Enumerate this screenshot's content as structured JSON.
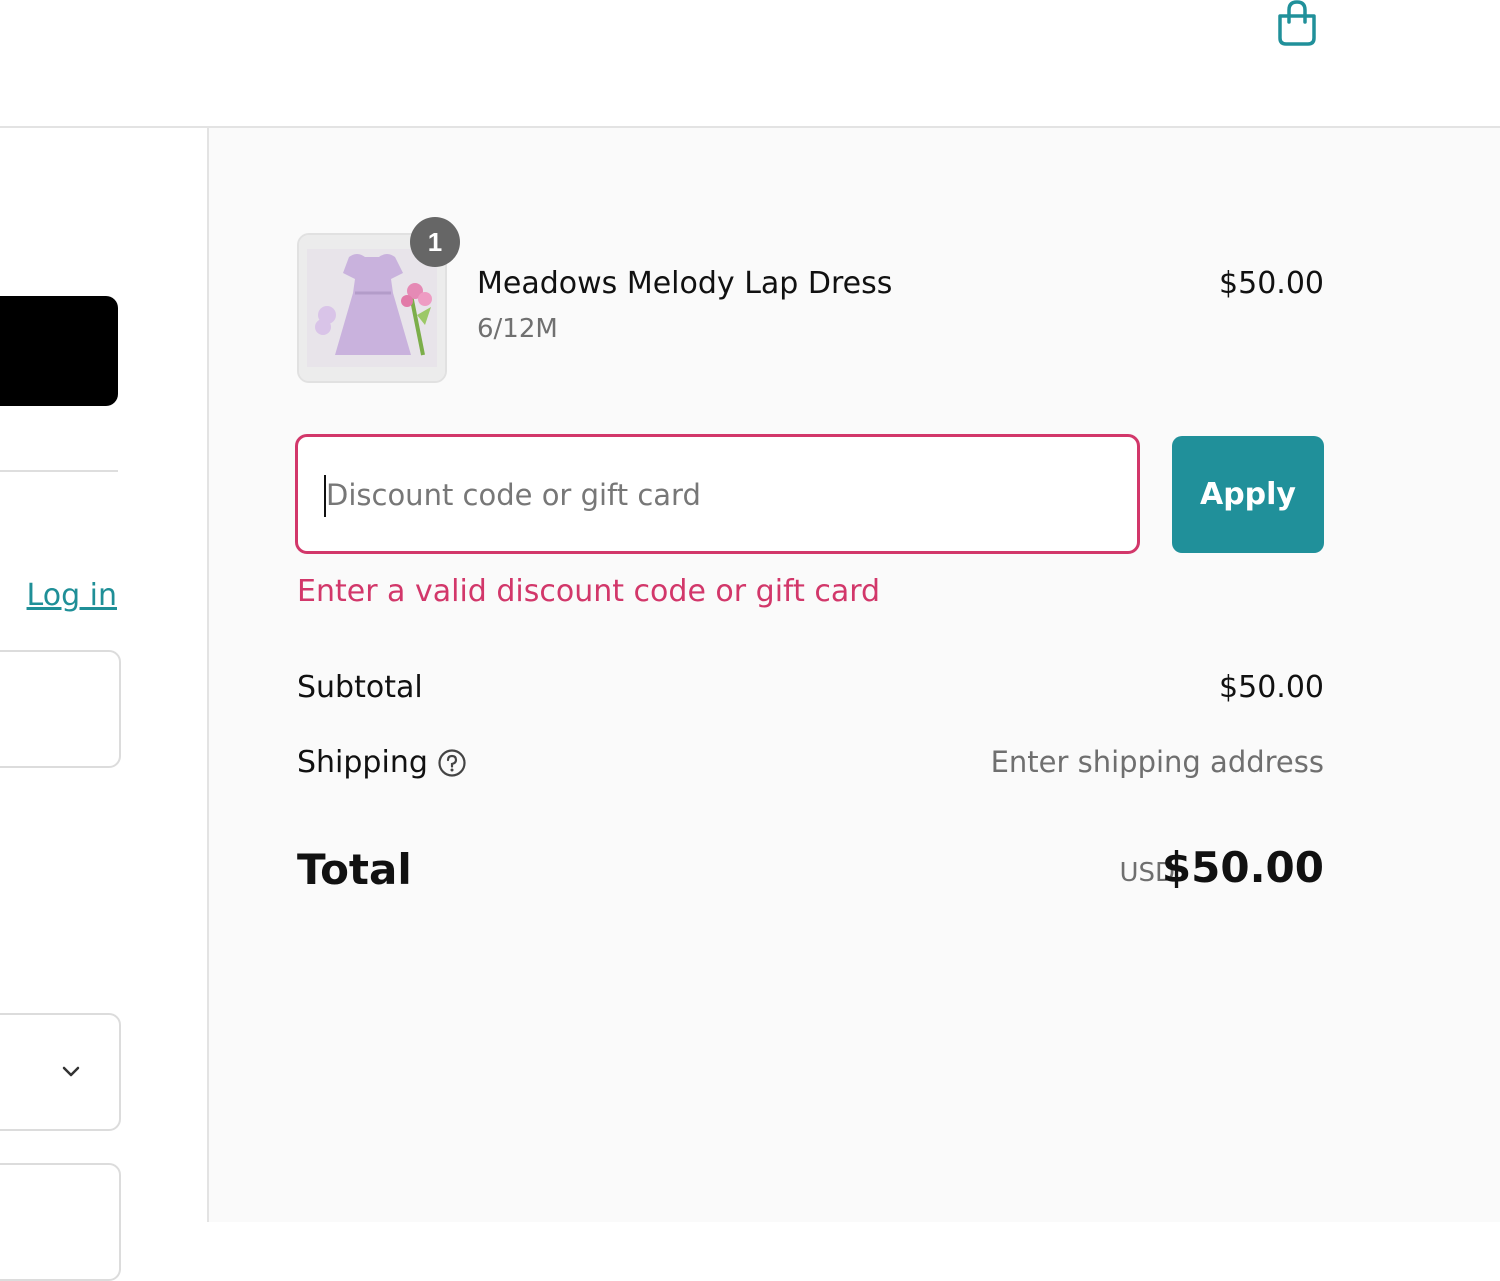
{
  "header": {
    "cart_icon": "shopping-bag-icon"
  },
  "left": {
    "login_label": "Log in",
    "chevron_icon": "chevron-down-icon"
  },
  "order": {
    "item": {
      "quantity": "1",
      "name": "Meadows Melody Lap Dress",
      "variant": "6/12M",
      "price": "$50.00"
    },
    "discount": {
      "placeholder": "Discount code or gift card",
      "value": "",
      "apply_label": "Apply",
      "error": "Enter a valid discount code or gift card"
    },
    "subtotal_label": "Subtotal",
    "subtotal_value": "$50.00",
    "shipping_label": "Shipping",
    "shipping_help_icon": "question-circle-icon",
    "shipping_value": "Enter shipping address",
    "total_label": "Total",
    "total_currency": "USD",
    "total_value": "$50.00"
  },
  "colors": {
    "accent": "#20909a",
    "error": "#d2376a",
    "link": "#1f8f97"
  }
}
